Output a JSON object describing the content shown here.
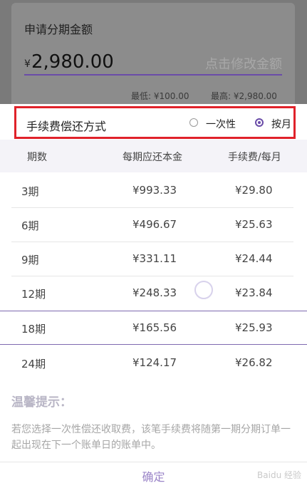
{
  "amount": {
    "title": "申请分期金额",
    "currency": "¥",
    "value": "2,980.00",
    "hint": "点击修改金额",
    "min": "最低: ¥100.00",
    "max": "最高: ¥2,980.00"
  },
  "method": {
    "label": "手续费偿还方式",
    "options": [
      "一次性",
      "按月"
    ],
    "selected": "按月"
  },
  "table": {
    "headers": [
      "期数",
      "每期应还本金",
      "手续费/每月"
    ],
    "rows": [
      [
        "3期",
        "¥993.33",
        "¥29.80"
      ],
      [
        "6期",
        "¥496.67",
        "¥25.63"
      ],
      [
        "9期",
        "¥331.11",
        "¥24.44"
      ],
      [
        "12期",
        "¥248.33",
        "¥23.84"
      ],
      [
        "18期",
        "¥165.56",
        "¥25.93"
      ],
      [
        "24期",
        "¥124.17",
        "¥26.82"
      ]
    ],
    "selected_row": "18期"
  },
  "tip": {
    "title": "温馨提示：",
    "text": "若您选择一次性偿还收取费，该笔手续费将随第一期分期订单一起出现在下一个账单日的账单中。"
  },
  "confirm_label": "确定",
  "watermark": "Baidu 经验"
}
